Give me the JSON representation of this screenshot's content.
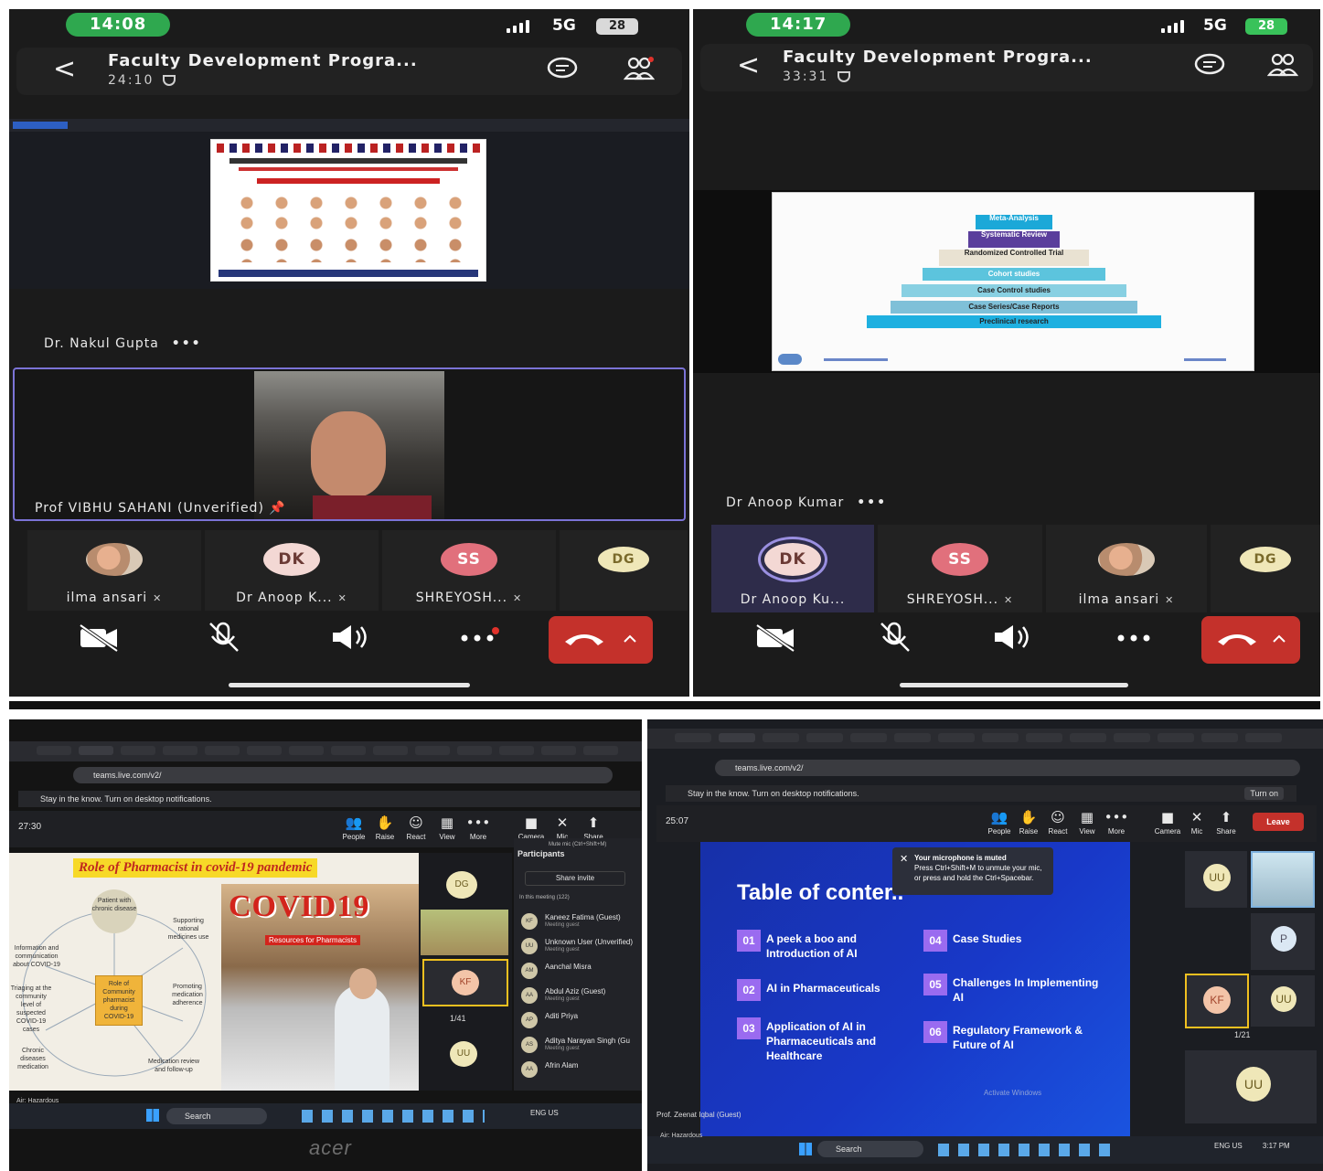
{
  "phone_left": {
    "status": {
      "time": "14:08",
      "network": "5G",
      "battery": "28"
    },
    "header": {
      "title": "Faculty Development Progra...",
      "timer": "24:10"
    },
    "presenter_name": "Dr. Nakul Gupta",
    "video_name": "Prof VIBHU SAHANI (Unverified)",
    "participants": [
      {
        "initials": "",
        "name": "ilma ansari"
      },
      {
        "initials": "DK",
        "name": "Dr Anoop K..."
      },
      {
        "initials": "SS",
        "name": "SHREYOSH..."
      },
      {
        "initials": "DG",
        "name": ""
      }
    ]
  },
  "phone_right": {
    "status": {
      "time": "14:17",
      "network": "5G",
      "battery": "28"
    },
    "header": {
      "title": "Faculty Development Progra...",
      "timer": "33:31"
    },
    "presenter_name": "Dr Anoop Kumar",
    "pyramid": {
      "levels": [
        "Meta-Analysis",
        "Systematic Review",
        "Randomized Controlled Trial",
        "Cohort studies",
        "Case Control studies",
        "Case Series/Case Reports",
        "Preclinical research"
      ]
    },
    "participants": [
      {
        "initials": "DK",
        "name": "Dr Anoop Ku..."
      },
      {
        "initials": "SS",
        "name": "SHREYOSH..."
      },
      {
        "initials": "",
        "name": "ilma ansari"
      },
      {
        "initials": "DG",
        "name": ""
      }
    ]
  },
  "photo_left": {
    "address": "teams.live.com/v2/",
    "notification": "Stay in the know. Turn on desktop notifications.",
    "timer": "27:30",
    "toolbar": [
      "People",
      "Raise",
      "React",
      "View",
      "More",
      "Camera",
      "Mic",
      "Share"
    ],
    "slide_title": "Role of Pharmacist in covid-19 pandemic",
    "covid_word": "COVID19",
    "resources_label": "Resources for Pharmacists",
    "mind_map": {
      "center": "Role of Community pharmacist during COVID-19",
      "nodes": [
        "Patient with chronic disease",
        "Supporting rational medicines use",
        "Information and communication about COVID-19",
        "Promoting medication adherence",
        "Triaging at the community level of suspected COVID-19 cases",
        "Chronic diseases medication",
        "Medication review and follow-up"
      ]
    },
    "pager": "1/41",
    "participants_panel": {
      "title": "Participants",
      "mute_hint": "Mute mic (Ctrl+Shift+M)",
      "share_invite": "Share invite",
      "in_meeting": "In this meeting (122)",
      "rows": [
        {
          "initials": "KF",
          "name": "Kaneez Fatima (Guest)",
          "sub": "Meeting guest"
        },
        {
          "initials": "UU",
          "name": "Unknown User (Unverified)",
          "sub": "Meeting guest"
        },
        {
          "initials": "AM",
          "name": "Aanchal Misra",
          "sub": ""
        },
        {
          "initials": "AA",
          "name": "Abdul Aziz (Guest)",
          "sub": "Meeting guest"
        },
        {
          "initials": "AP",
          "name": "Aditi Priya",
          "sub": ""
        },
        {
          "initials": "AS",
          "name": "Aditya Narayan Singh (Gu",
          "sub": "Meeting guest"
        },
        {
          "initials": "AA",
          "name": "Afrin Alam",
          "sub": ""
        }
      ]
    },
    "side_avatars": [
      "DG",
      "KF",
      "UU"
    ],
    "taskbar": {
      "search": "Search",
      "lang": "ENG US"
    },
    "caption": "Air: Hazardous",
    "brand": "acer"
  },
  "photo_right": {
    "address": "teams.live.com/v2/",
    "notification": "Stay in the know. Turn on desktop notifications.",
    "turn_on": "Turn on",
    "timer": "25:07",
    "toolbar": [
      "People",
      "Raise",
      "React",
      "View",
      "More",
      "Camera",
      "Mic",
      "Share"
    ],
    "leave_label": "Leave",
    "toc_title": "Table of conter..",
    "toc_items": [
      {
        "num": "01",
        "text": "A peek a boo and Introduction of AI"
      },
      {
        "num": "02",
        "text": "AI in Pharmaceuticals"
      },
      {
        "num": "03",
        "text": "Application of AI in Pharmaceuticals and Healthcare"
      },
      {
        "num": "04",
        "text": "Case Studies"
      },
      {
        "num": "05",
        "text": "Challenges In Implementing AI"
      },
      {
        "num": "06",
        "text": "Regulatory Framework & Future of AI"
      }
    ],
    "mic_toast": {
      "title": "Your microphone is muted",
      "body": "Press Ctrl+Shift+M to unmute your mic, or press and hold the Ctrl+Spacebar."
    },
    "watermark": "Activate Windows",
    "presenter_label": "Prof. Zeenat Iqbal (Guest)",
    "gallery": [
      "UU",
      "P",
      "KF",
      "UU",
      "UU"
    ],
    "pager": "1/21",
    "taskbar": {
      "search": "Search",
      "lang": "ENG US",
      "clock": "3:17 PM"
    },
    "caption": "Air: Hazardous"
  },
  "colors": {
    "call_bg": "#1b1b1b",
    "leave_red": "#c4312b",
    "time_green": "#2fa84f",
    "highlight_purple": "#7b73d6"
  }
}
